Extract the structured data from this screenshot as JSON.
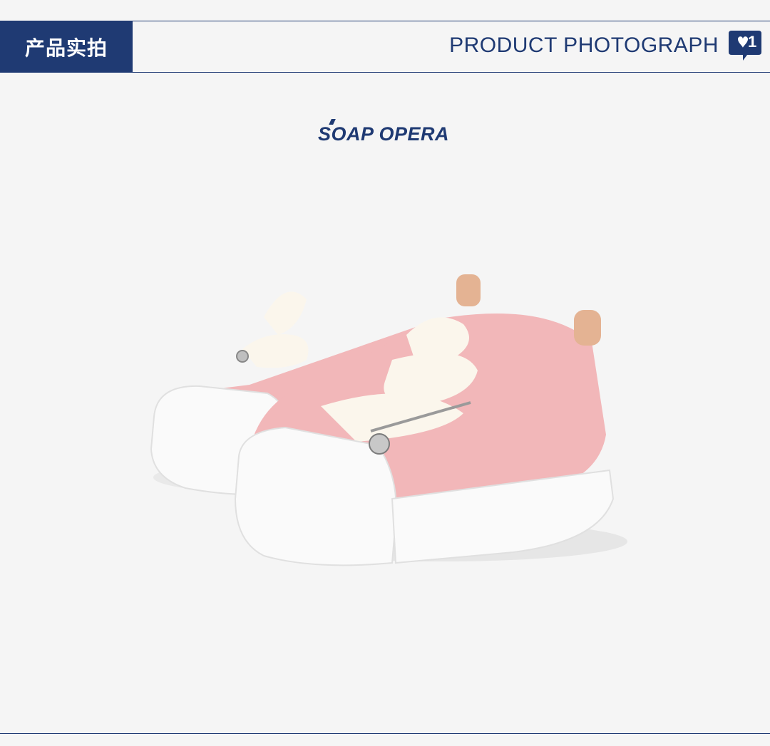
{
  "header": {
    "tab_label": "产品实拍",
    "subtitle": "PRODUCT PHOTOGRAPH",
    "badge": {
      "icon": "heart-chat-icon",
      "count": "1"
    }
  },
  "brand": {
    "logo_text": "SOAP OPERA"
  },
  "product": {
    "image": "pink-tweed-sneakers-photo"
  },
  "colors": {
    "brand_navy": "#1f3a73",
    "background": "#f5f5f5",
    "shoe_pink": "#f2b7b9",
    "sole_white": "#fafafa"
  }
}
